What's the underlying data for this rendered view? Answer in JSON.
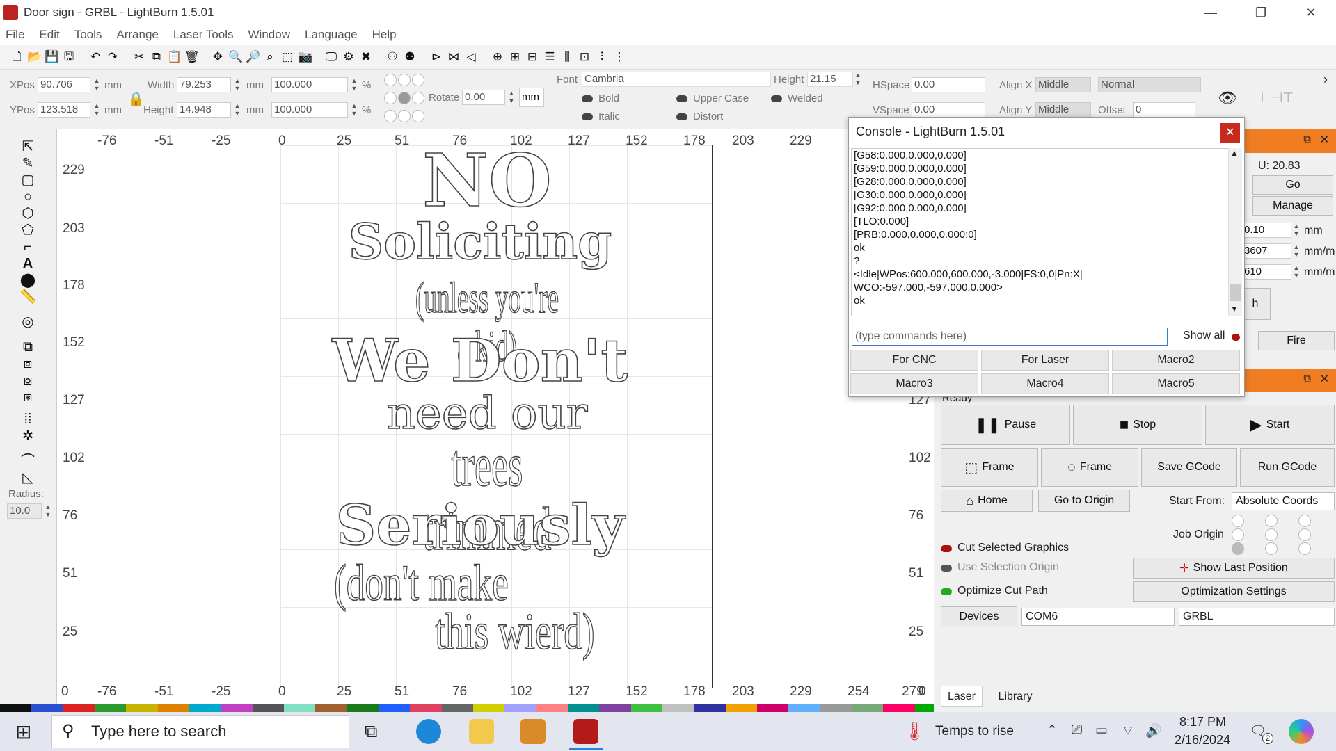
{
  "window": {
    "title": "Door sign - GRBL - LightBurn 1.5.01",
    "min": "—",
    "max": "❐",
    "close": "✕"
  },
  "menu": [
    "File",
    "Edit",
    "Tools",
    "Arrange",
    "Laser Tools",
    "Window",
    "Language",
    "Help"
  ],
  "props": {
    "xpos_label": "XPos",
    "xpos": "90.706",
    "ypos_label": "YPos",
    "ypos": "123.518",
    "unit": "mm",
    "width_label": "Width",
    "width": "79.253",
    "height_label": "Height",
    "height": "14.948",
    "scale_w": "100.000",
    "scale_h": "100.000",
    "pct": "%",
    "rotate_label": "Rotate",
    "rotate": "0.00",
    "mm_btn": "mm",
    "font_label": "Font",
    "font": "Cambria",
    "fheight_label": "Height",
    "fheight": "21.15",
    "bold": "Bold",
    "italic": "Italic",
    "upper": "Upper Case",
    "distort": "Distort",
    "welded": "Welded",
    "hspace_label": "HSpace",
    "hspace": "0.00",
    "vspace_label": "VSpace",
    "vspace": "0.00",
    "alignx_label": "Align X",
    "alignx": "Middle",
    "aligny_label": "Align Y",
    "aligny": "Middle",
    "normal": "Normal",
    "offset_label": "Offset",
    "offset": "0"
  },
  "left": {
    "radius_label": "Radius:",
    "radius": "10.0"
  },
  "ruler": {
    "top": [
      "-76",
      "-51",
      "-25",
      "0",
      "25",
      "51",
      "76",
      "102",
      "127",
      "152",
      "178",
      "203",
      "229"
    ],
    "bottom": [
      "0",
      "-76",
      "-51",
      "-25",
      "0",
      "25",
      "51",
      "76",
      "102",
      "127",
      "152",
      "178",
      "203",
      "229",
      "254",
      "279",
      "0"
    ],
    "left": [
      "229",
      "203",
      "178",
      "152",
      "127",
      "102",
      "76",
      "51",
      "25"
    ],
    "right": [
      "127",
      "102",
      "76",
      "51",
      "25"
    ]
  },
  "design": [
    "NO",
    "Soliciting",
    "(unless you're a kid)",
    "We Don't",
    "need our",
    "trees trimmed",
    "Seriously",
    "(don't make",
    "this wierd)"
  ],
  "console": {
    "title": "Console - LightBurn 1.5.01",
    "output": "[G58:0.000,0.000,0.000]\n[G59:0.000,0.000,0.000]\n[G28:0.000,0.000,0.000]\n[G30:0.000,0.000,0.000]\n[G92:0.000,0.000,0.000]\n[TLO:0.000]\n[PRB:0.000,0.000,0.000:0]\nok\n?\n<Idle|WPos:600.000,600.000,-3.000|FS:0,0|Pn:X|\nWCO:-597.000,-597.000,0.000>\nok",
    "placeholder": "(type commands here)",
    "show_all": "Show all",
    "macros": [
      "For CNC",
      "For Laser",
      "Macro2",
      "Macro3",
      "Macro4",
      "Macro5"
    ]
  },
  "move": {
    "u": "U: 20.83",
    "go": "Go",
    "manage": "Manage",
    "v1": "0.10",
    "v2": "3607",
    "v3": "610",
    "u1": "mm",
    "u2": "mm/m",
    "u3": "mm/m",
    "h": "h",
    "fire": "Fire"
  },
  "laser": {
    "status": "Ready",
    "pause": "Pause",
    "stop": "Stop",
    "start": "Start",
    "frame1": "Frame",
    "frame2": "Frame",
    "save": "Save GCode",
    "run": "Run GCode",
    "home": "Home",
    "goorigin": "Go to Origin",
    "startfrom_label": "Start From:",
    "startfrom": "Absolute Coords",
    "joborigin": "Job Origin",
    "cutsel": "Cut Selected Graphics",
    "usesel": "Use Selection Origin",
    "showlast": "Show Last Position",
    "optimize": "Optimize Cut Path",
    "optset": "Optimization Settings",
    "devices": "Devices",
    "port": "COM6",
    "ctrl": "GRBL"
  },
  "tabs": [
    "Laser",
    "Library"
  ],
  "taskbar": {
    "search": "Type here to search",
    "weather": "Temps to rise",
    "time": "8:17 PM",
    "date": "2/16/2024",
    "notif": "2"
  },
  "palette": [
    "#111",
    "#2a4fd0",
    "#d22",
    "#2a9a2a",
    "#c8b400",
    "#e08000",
    "#00aacc",
    "#c040c0",
    "#555",
    "#80e0c0",
    "#a06030",
    "#1a7a1a",
    "#2060ff",
    "#e04060",
    "#666",
    "#d0d000",
    "#a0a0ff",
    "#ff8080",
    "#009090",
    "#8040a0",
    "#40c040",
    "#c0c0c0",
    "#3030a0",
    "#f0a000",
    "#cc0066",
    "#60b0ff",
    "#999",
    "#7a7",
    "#f06",
    "#0a0"
  ]
}
